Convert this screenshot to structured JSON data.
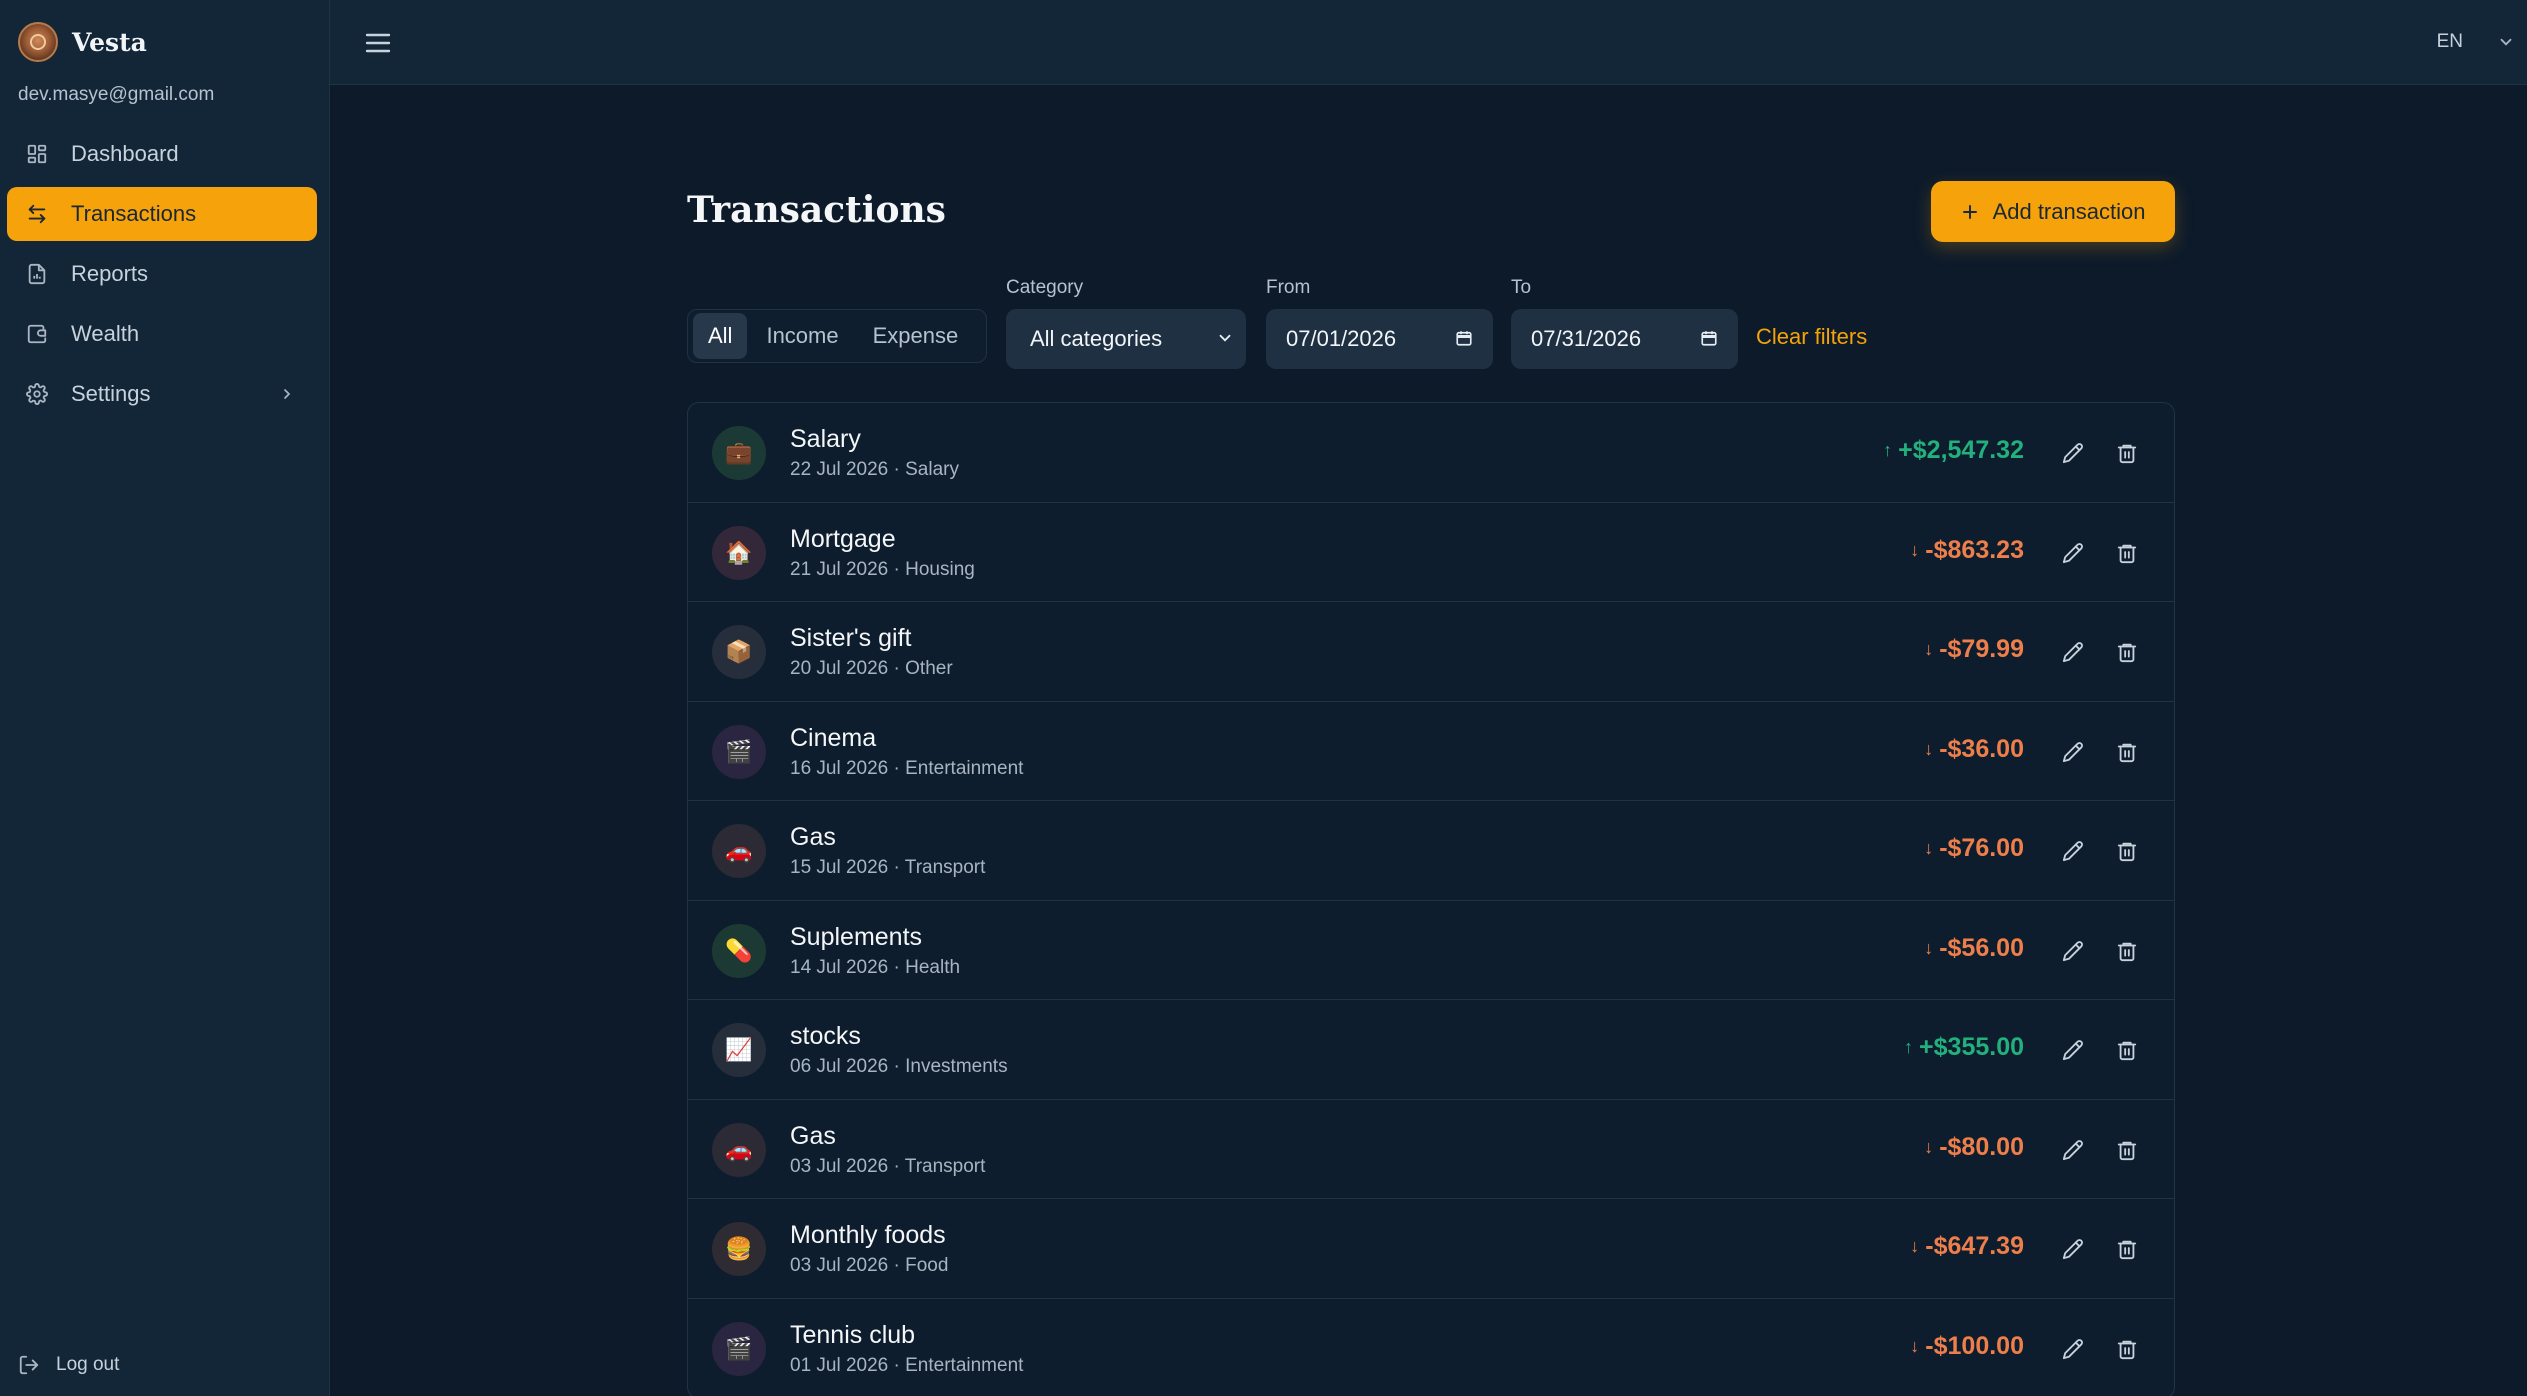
{
  "app": {
    "name": "Vesta",
    "user_email": "dev.masye@gmail.com"
  },
  "sidebar": {
    "items": [
      {
        "label": "Dashboard",
        "icon": "dashboard-icon"
      },
      {
        "label": "Transactions",
        "icon": "transactions-icon",
        "active": true
      },
      {
        "label": "Reports",
        "icon": "reports-icon"
      },
      {
        "label": "Wealth",
        "icon": "wallet-icon"
      },
      {
        "label": "Settings",
        "icon": "gear-icon",
        "has_submenu": true
      }
    ],
    "logout_label": "Log out"
  },
  "header": {
    "language": "EN"
  },
  "page": {
    "title": "Transactions",
    "add_button_label": "Add transaction"
  },
  "filters": {
    "type_options": [
      "All",
      "Income",
      "Expense"
    ],
    "type_selected": "All",
    "category_label": "Category",
    "category_value": "All categories",
    "from_label": "From",
    "from_value": "07/01/2026",
    "to_label": "To",
    "to_value": "07/31/2026",
    "clear_label": "Clear filters"
  },
  "transactions": [
    {
      "title": "Salary",
      "subtitle": "22 Jul 2026 · Salary",
      "amount": "+$2,547.32",
      "type": "income",
      "icon": "💼",
      "icon_bg": "#1b3a35"
    },
    {
      "title": "Mortgage",
      "subtitle": "21 Jul 2026 · Housing",
      "amount": "-$863.23",
      "type": "expense",
      "icon": "🏠",
      "icon_bg": "#33283a"
    },
    {
      "title": "Sister's gift",
      "subtitle": "20 Jul 2026 · Other",
      "amount": "-$79.99",
      "type": "expense",
      "icon": "📦",
      "icon_bg": "#252e3a"
    },
    {
      "title": "Cinema",
      "subtitle": "16 Jul 2026 · Entertainment",
      "amount": "-$36.00",
      "type": "expense",
      "icon": "🎬",
      "icon_bg": "#2a2540"
    },
    {
      "title": "Gas",
      "subtitle": "15 Jul 2026 · Transport",
      "amount": "-$76.00",
      "type": "expense",
      "icon": "🚗",
      "icon_bg": "#2b2a35"
    },
    {
      "title": "Suplements",
      "subtitle": "14 Jul 2026 · Health",
      "amount": "-$56.00",
      "type": "expense",
      "icon": "💊",
      "icon_bg": "#1c3a33"
    },
    {
      "title": "stocks",
      "subtitle": "06 Jul 2026 · Investments",
      "amount": "+$355.00",
      "type": "income",
      "icon": "📈",
      "icon_bg": "#252e3a"
    },
    {
      "title": "Gas",
      "subtitle": "03 Jul 2026 · Transport",
      "amount": "-$80.00",
      "type": "expense",
      "icon": "🚗",
      "icon_bg": "#2b2a35"
    },
    {
      "title": "Monthly foods",
      "subtitle": "03 Jul 2026 · Food",
      "amount": "-$647.39",
      "type": "expense",
      "icon": "🍔",
      "icon_bg": "#2e2b33"
    },
    {
      "title": "Tennis club",
      "subtitle": "01 Jul 2026 · Entertainment",
      "amount": "-$100.00",
      "type": "expense",
      "icon": "🎬",
      "icon_bg": "#2a2540"
    }
  ],
  "colors": {
    "accent": "#f5a20b",
    "income": "#22b07d",
    "expense": "#ee7f4b",
    "background": "#0c1a2a",
    "sidebar": "#132638"
  }
}
